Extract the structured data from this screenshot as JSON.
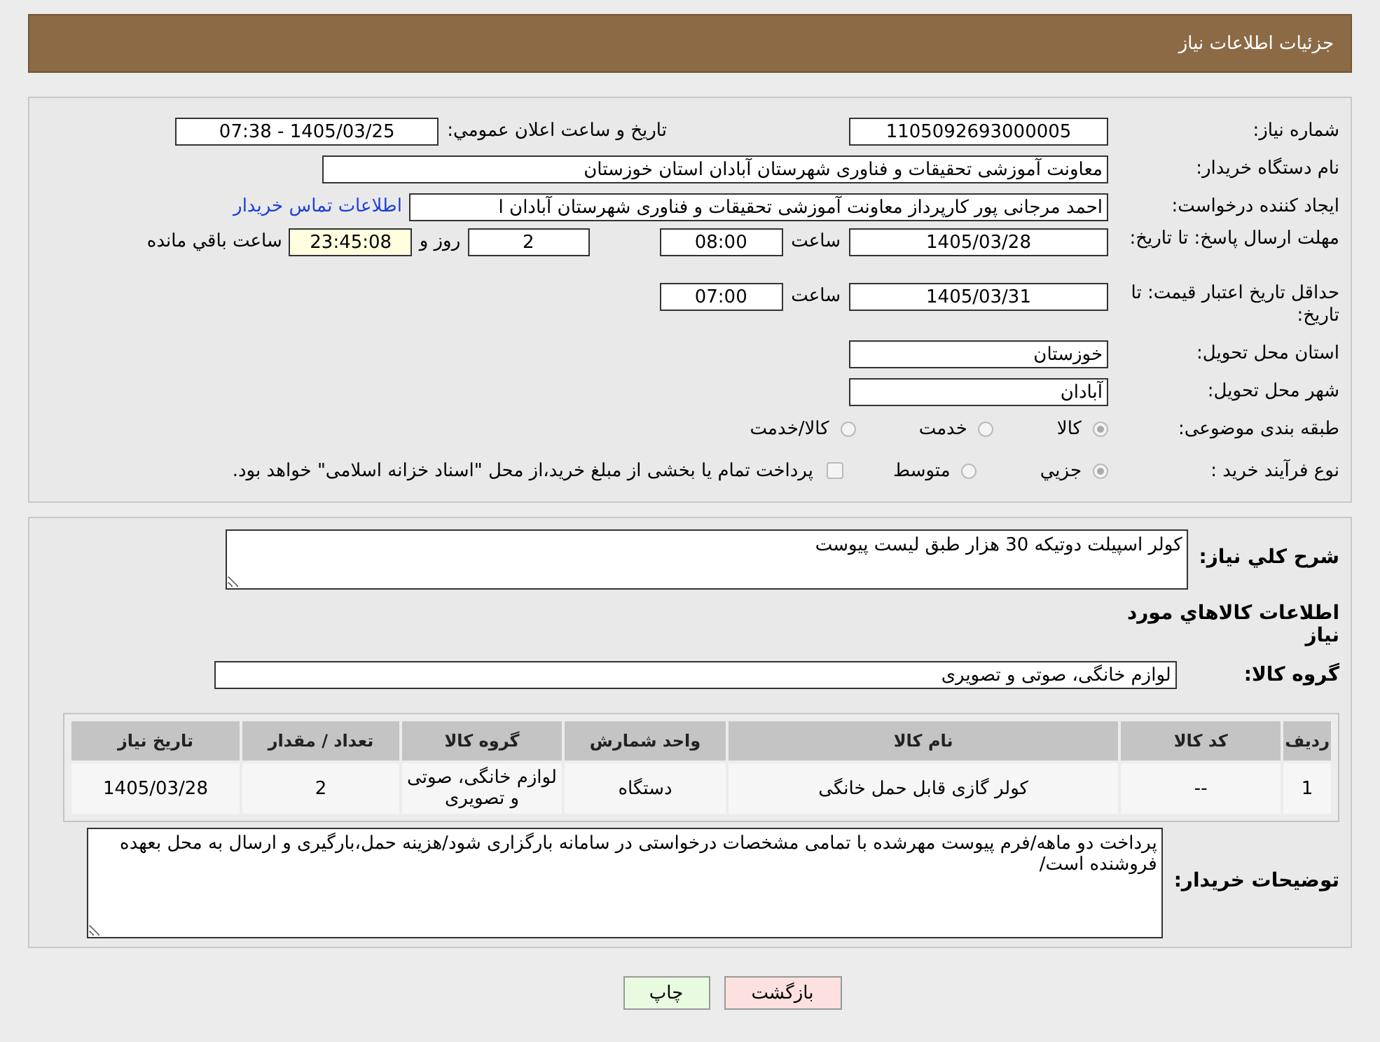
{
  "header": {
    "title": "جزئیات اطلاعات نیاز"
  },
  "need_number": {
    "label": "شماره نیاز:",
    "value": "1105092693000005"
  },
  "announce": {
    "label": "تاریخ و ساعت اعلان عمومي:",
    "value": "1405/03/25 - 07:38"
  },
  "buyer": {
    "label": "نام دستگاه خریدار:",
    "value": "معاونت آموزشی  تحقیقات و فناوری شهرستان آبادان استان خوزستان"
  },
  "requester": {
    "label": "ایجاد کننده درخواست:",
    "value": "احمد  مرجانی پور کارپرداز معاونت آموزشی  تحقیقات و فناوری شهرستان آبادان ا",
    "link": "اطلاعات تماس خريدار"
  },
  "deadline": {
    "label": "مهلت ارسال پاسخ: تا تاریخ:",
    "date": "1405/03/28",
    "time_label": "ساعت",
    "time": "08:00",
    "days": "2",
    "days_label": "روز و",
    "remaining": "23:45:08",
    "remaining_label": "ساعت باقي مانده"
  },
  "validity": {
    "label": "حداقل تاریخ اعتبار قیمت: تا تاریخ:",
    "date": "1405/03/31",
    "time_label": "ساعت",
    "time": "07:00"
  },
  "province": {
    "label": "استان محل تحویل:",
    "value": "خوزستان"
  },
  "city": {
    "label": "شهر محل تحویل:",
    "value": "آبادان"
  },
  "category": {
    "label": "طبقه بندی موضوعی:",
    "options": [
      {
        "label": "کالا",
        "selected": true
      },
      {
        "label": "خدمت",
        "selected": false
      },
      {
        "label": "کالا/خدمت",
        "selected": false
      }
    ]
  },
  "process": {
    "label": "نوع فرآیند خرید :",
    "options": [
      {
        "label": "جزيي",
        "selected": true
      },
      {
        "label": "متوسط",
        "selected": false
      }
    ],
    "payment": {
      "checked": false,
      "text": "پرداخت تمام یا بخشی از مبلغ خرید،از محل \"اسناد خزانه اسلامی\" خواهد بود."
    }
  },
  "description": {
    "label": "شرح كلي نياز:",
    "value": "کولر اسپیلت دوتیکه 30 هزار طبق لیست پیوست"
  },
  "goods_heading": "اطلاعات كالاهاي مورد نياز",
  "goods_group": {
    "label": "گروه كالا:",
    "value": "لوازم خانگی، صوتی و تصویری"
  },
  "table": {
    "columns": [
      "ردیف",
      "کد کالا",
      "نام کالا",
      "واحد شمارش",
      "گروه کالا",
      "تعداد / مقدار",
      "تاریخ نیاز"
    ],
    "rows": [
      [
        "1",
        "--",
        "کولر گازی قابل حمل خانگی",
        "دستگاه",
        "لوازم خانگی، صوتی و تصویری",
        "2",
        "1405/03/28"
      ]
    ]
  },
  "buyer_notes": {
    "label": "توضیحات خریدار:",
    "value": "پرداخت دو ماهه/فرم پیوست مهرشده با تمامی مشخصات درخواستی در سامانه بارگزاری شود/هزینه حمل،بارگیری و ارسال به محل بعهده فروشنده است/"
  },
  "buttons": [
    {
      "kind": "back",
      "label": "بازگشت"
    },
    {
      "kind": "print",
      "label": "چاپ"
    }
  ]
}
